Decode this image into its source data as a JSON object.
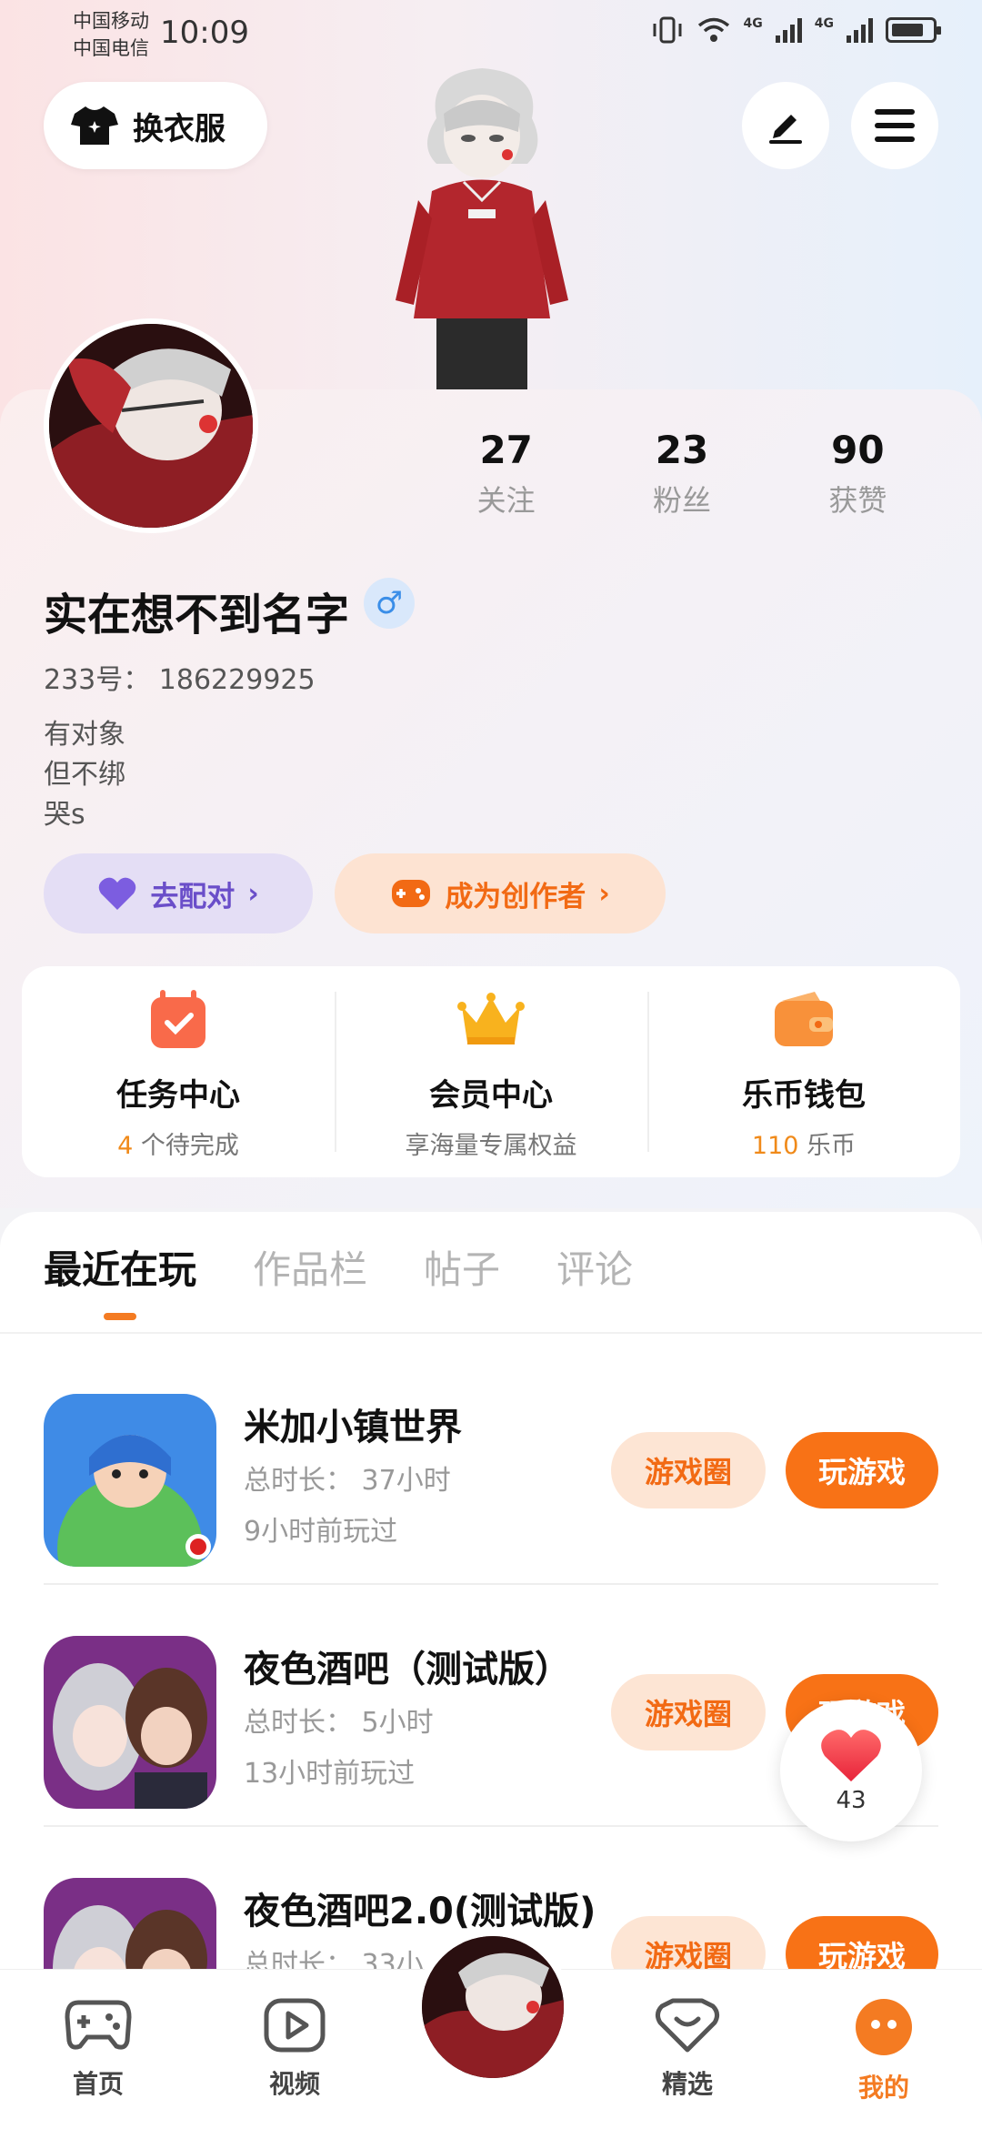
{
  "status_bar": {
    "carrier_1": "中国移动",
    "carrier_2": "中国电信",
    "time": "10:09",
    "net_1": "4G",
    "net_2": "4G"
  },
  "header": {
    "outfit_label": "换衣服"
  },
  "profile": {
    "stats": [
      {
        "value": "27",
        "label": "关注"
      },
      {
        "value": "23",
        "label": "粉丝"
      },
      {
        "value": "90",
        "label": "获赞"
      }
    ],
    "username": "实在想不到名字",
    "gender_symbol": "♂",
    "uid_text": "233号：  186229925",
    "bio_lines": [
      "有对象",
      "但不绑",
      "哭s"
    ],
    "match_label": "去配对",
    "creator_label": "成为创作者"
  },
  "features": [
    {
      "title": "任务中心",
      "sub_prefix": "4",
      "sub_text": " 个待完成"
    },
    {
      "title": "会员中心",
      "sub_prefix": "",
      "sub_text": "享海量专属权益"
    },
    {
      "title": "乐币钱包",
      "sub_prefix": "110",
      "sub_text": " 乐币"
    }
  ],
  "tabs": [
    "最近在玩",
    "作品栏",
    "帖子",
    "评论"
  ],
  "games": [
    {
      "name": "米加小镇世界",
      "duration": "总时长：  37小时",
      "last_played": "9小时前玩过",
      "circle_label": "游戏圈",
      "play_label": "玩游戏"
    },
    {
      "name": "夜色酒吧（测试版）",
      "duration": "总时长：  5小时",
      "last_played": "13小时前玩过",
      "circle_label": "游戏圈",
      "play_label": "玩游戏"
    },
    {
      "name": "夜色酒吧2.0(测试版)",
      "duration": "总时长：  33小",
      "last_played": "",
      "circle_label": "游戏圈",
      "play_label": "玩游戏"
    }
  ],
  "like_float": {
    "count": "43"
  },
  "bottom_nav": [
    {
      "label": "首页",
      "icon": "gamepad-icon"
    },
    {
      "label": "视频",
      "icon": "video-icon"
    },
    {
      "label": "精选",
      "icon": "heart-badge-icon"
    },
    {
      "label": "我的",
      "icon": "profile-face-icon"
    }
  ],
  "colors": {
    "accent": "#f87216",
    "match_purple": "#6a4ec9",
    "link_orange": "#f26a14"
  }
}
